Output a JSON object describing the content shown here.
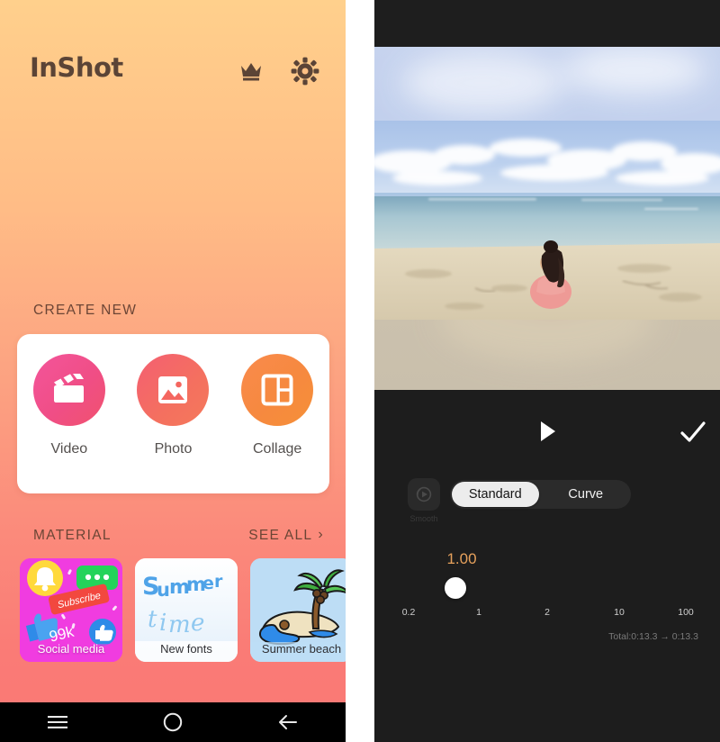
{
  "left_phone": {
    "header": {
      "app_name": "InShot",
      "crown_icon": "crown-icon",
      "gear_icon": "gear-icon"
    },
    "create_new": {
      "section_label": "CREATE NEW",
      "items": [
        {
          "label": "Video",
          "icon": "clapperboard-icon",
          "color": "#F2539A"
        },
        {
          "label": "Photo",
          "icon": "image-icon",
          "color": "#F4665F"
        },
        {
          "label": "Collage",
          "icon": "collage-grid-icon",
          "color": "#F78A42"
        }
      ]
    },
    "material": {
      "section_label": "MATERIAL",
      "see_all_label": "SEE ALL",
      "see_all_chevron": "›",
      "cards": [
        {
          "label": "Social media",
          "badge_text": "Subscribe",
          "count_text": "99k",
          "bg": "#F03CE0"
        },
        {
          "label": "New fonts",
          "art_line1": "Summer",
          "art_line2": "time",
          "bg": "#FFFFFF"
        },
        {
          "label": "Summer beach",
          "bg": "#BDDDF5"
        }
      ]
    },
    "nav": {
      "recents_icon": "menu-icon",
      "home_icon": "circle-home-icon",
      "back_icon": "back-arrow-icon"
    }
  },
  "right_phone": {
    "preview": {
      "scene": "beach-video-preview"
    },
    "toolbar": {
      "play_icon": "play-icon",
      "confirm_icon": "check-icon"
    },
    "speed_panel": {
      "smooth_label": "Smooth",
      "smooth_icon": "smooth-speed-icon",
      "tabs": [
        {
          "label": "Standard",
          "active": true
        },
        {
          "label": "Curve",
          "active": false
        }
      ],
      "speed_value": "1.00",
      "value_color": "#E6A15C",
      "ticks": [
        "0.2",
        "1",
        "2",
        "10",
        "100"
      ],
      "total_text": "Total:0:13.3 → 0:13.3"
    },
    "nav": {
      "recents_icon": "menu-icon",
      "home_icon": "circle-home-icon",
      "back_icon": "back-arrow-icon"
    }
  }
}
